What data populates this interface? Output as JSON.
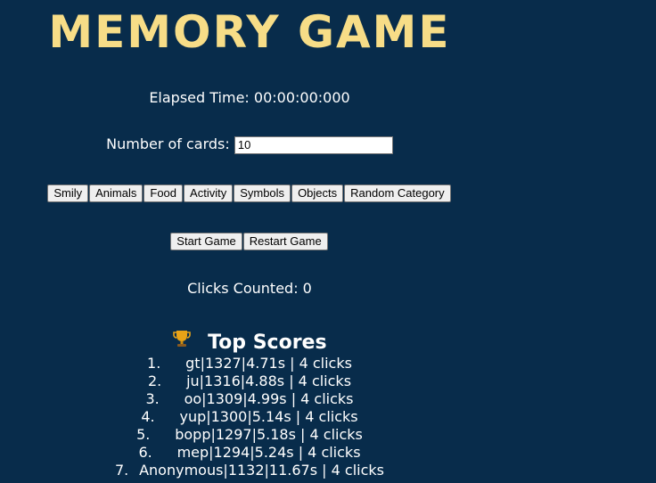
{
  "title": "MEMORY GAME",
  "elapsed": {
    "label": "Elapsed Time:",
    "value": "00:00:00:000"
  },
  "cards": {
    "label": "Number of cards:",
    "value": "10"
  },
  "categories": [
    "Smily",
    "Animals",
    "Food",
    "Activity",
    "Symbols",
    "Objects",
    "Random Category"
  ],
  "controls": {
    "start_label": "Start Game",
    "restart_label": "Restart Game"
  },
  "clicks": {
    "label": "Clicks Counted:",
    "value": "0"
  },
  "top_scores": {
    "icon": "trophy-icon",
    "heading": "Top Scores",
    "entries": [
      {
        "rank": "1.",
        "text": "gt|1327|4.71s | 4 clicks"
      },
      {
        "rank": "2.",
        "text": "ju|1316|4.88s | 4 clicks"
      },
      {
        "rank": "3.",
        "text": "oo|1309|4.99s | 4 clicks"
      },
      {
        "rank": "4.",
        "text": "yup|1300|5.14s | 4 clicks"
      },
      {
        "rank": "5.",
        "text": "bopp|1297|5.18s | 4 clicks"
      },
      {
        "rank": "6.",
        "text": "mep|1294|5.24s | 4 clicks"
      },
      {
        "rank": "7.",
        "text": "Anonymous|1132|11.67s | 4 clicks"
      }
    ]
  }
}
